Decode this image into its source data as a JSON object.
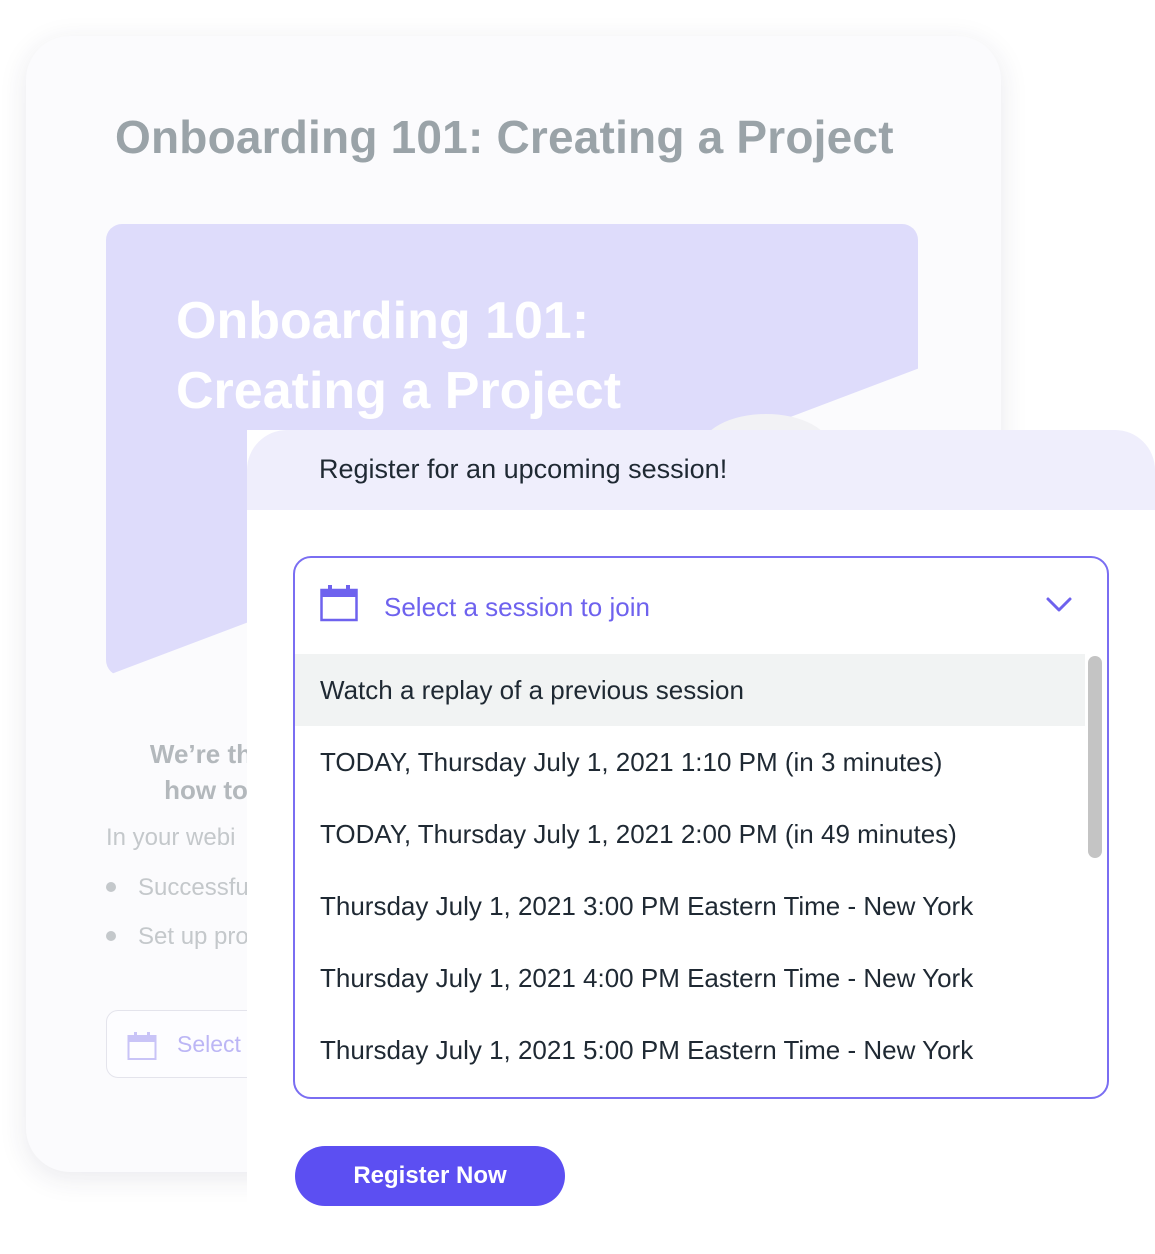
{
  "background_card": {
    "title": "Onboarding 101: Creating a Project",
    "banner_title_line1": "Onboarding 101:",
    "banner_title_line2": "Creating a Project",
    "heading_line1": "We’re thr",
    "heading_line2": "how to",
    "intro_text": "In your webi",
    "bullets": [
      "Successfu",
      "Set up pro"
    ],
    "select_label": "Select"
  },
  "panel": {
    "header_title": "Register for an upcoming session!",
    "dropdown": {
      "placeholder": "Select a session to join",
      "options": [
        "Watch a replay of a previous session",
        "TODAY, Thursday July 1, 2021 1:10 PM (in 3 minutes)",
        "TODAY, Thursday July 1, 2021 2:00 PM (in 49 minutes)",
        "Thursday July 1, 2021 3:00 PM Eastern Time - New York",
        "Thursday July 1, 2021 4:00 PM Eastern Time - New York",
        "Thursday July 1, 2021 5:00 PM Eastern Time - New York"
      ],
      "highlighted_index": 0
    },
    "register_button": "Register Now"
  },
  "icons": {
    "calendar": "calendar-icon",
    "chevron": "chevron-down-icon"
  },
  "colors": {
    "accent": "#5c4ff2",
    "dropdown_border": "#7a6ef2",
    "placeholder_text": "#6e62ee",
    "header_bg": "#efeefc",
    "banner_bg": "#dedcfb",
    "highlight_row": "#f1f3f3"
  }
}
